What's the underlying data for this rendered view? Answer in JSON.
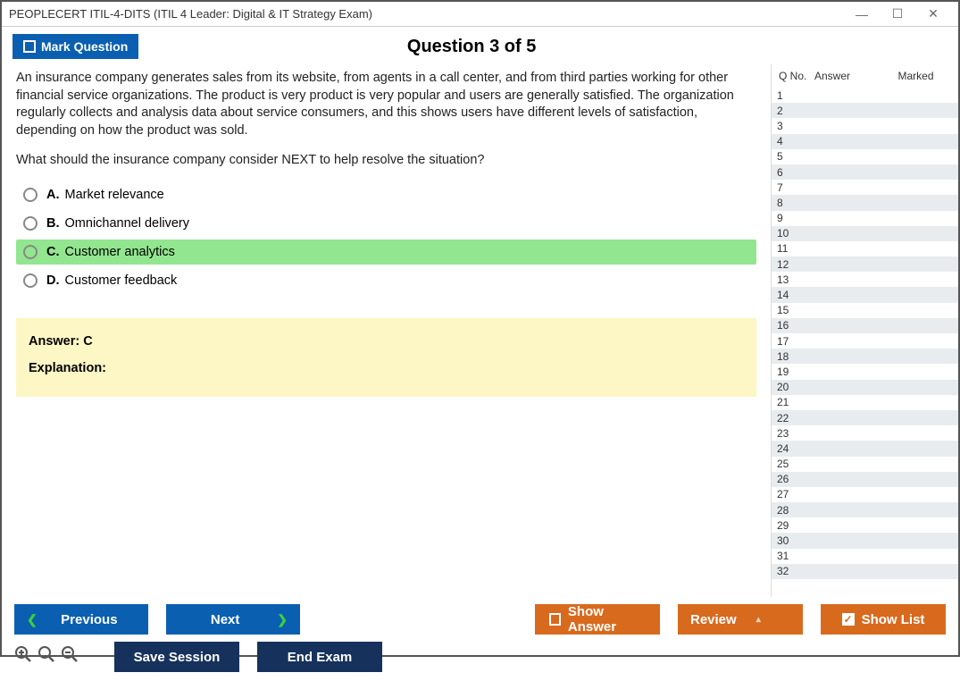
{
  "window": {
    "title": "PEOPLECERT ITIL-4-DITS (ITIL 4 Leader: Digital & IT Strategy Exam)"
  },
  "toolbar": {
    "mark_label": "Mark Question",
    "question_heading": "Question 3 of 5"
  },
  "question": {
    "body": "An insurance company generates sales from its website, from agents in a call center, and from third parties working for other financial service organizations. The product is very product is very popular and users are generally satisfied. The organization regularly collects and analysis data about service consumers, and this shows users have different levels of satisfaction, depending on how the product was sold.",
    "prompt": "What should the insurance company consider NEXT to help resolve the situation?",
    "options": [
      {
        "letter": "A.",
        "text": "Market relevance",
        "selected": false
      },
      {
        "letter": "B.",
        "text": "Omnichannel delivery",
        "selected": false
      },
      {
        "letter": "C.",
        "text": "Customer analytics",
        "selected": true
      },
      {
        "letter": "D.",
        "text": "Customer feedback",
        "selected": false
      }
    ]
  },
  "answer": {
    "line": "Answer: C",
    "explanation_label": "Explanation:"
  },
  "sidebar": {
    "headers": {
      "qno": "Q No.",
      "answer": "Answer",
      "marked": "Marked"
    },
    "rows": [
      1,
      2,
      3,
      4,
      5,
      6,
      7,
      8,
      9,
      10,
      11,
      12,
      13,
      14,
      15,
      16,
      17,
      18,
      19,
      20,
      21,
      22,
      23,
      24,
      25,
      26,
      27,
      28,
      29,
      30,
      31,
      32
    ]
  },
  "footer": {
    "previous": "Previous",
    "next": "Next",
    "show_answer": "Show Answer",
    "review": "Review",
    "show_list": "Show List",
    "save_session": "Save Session",
    "end_exam": "End Exam"
  }
}
